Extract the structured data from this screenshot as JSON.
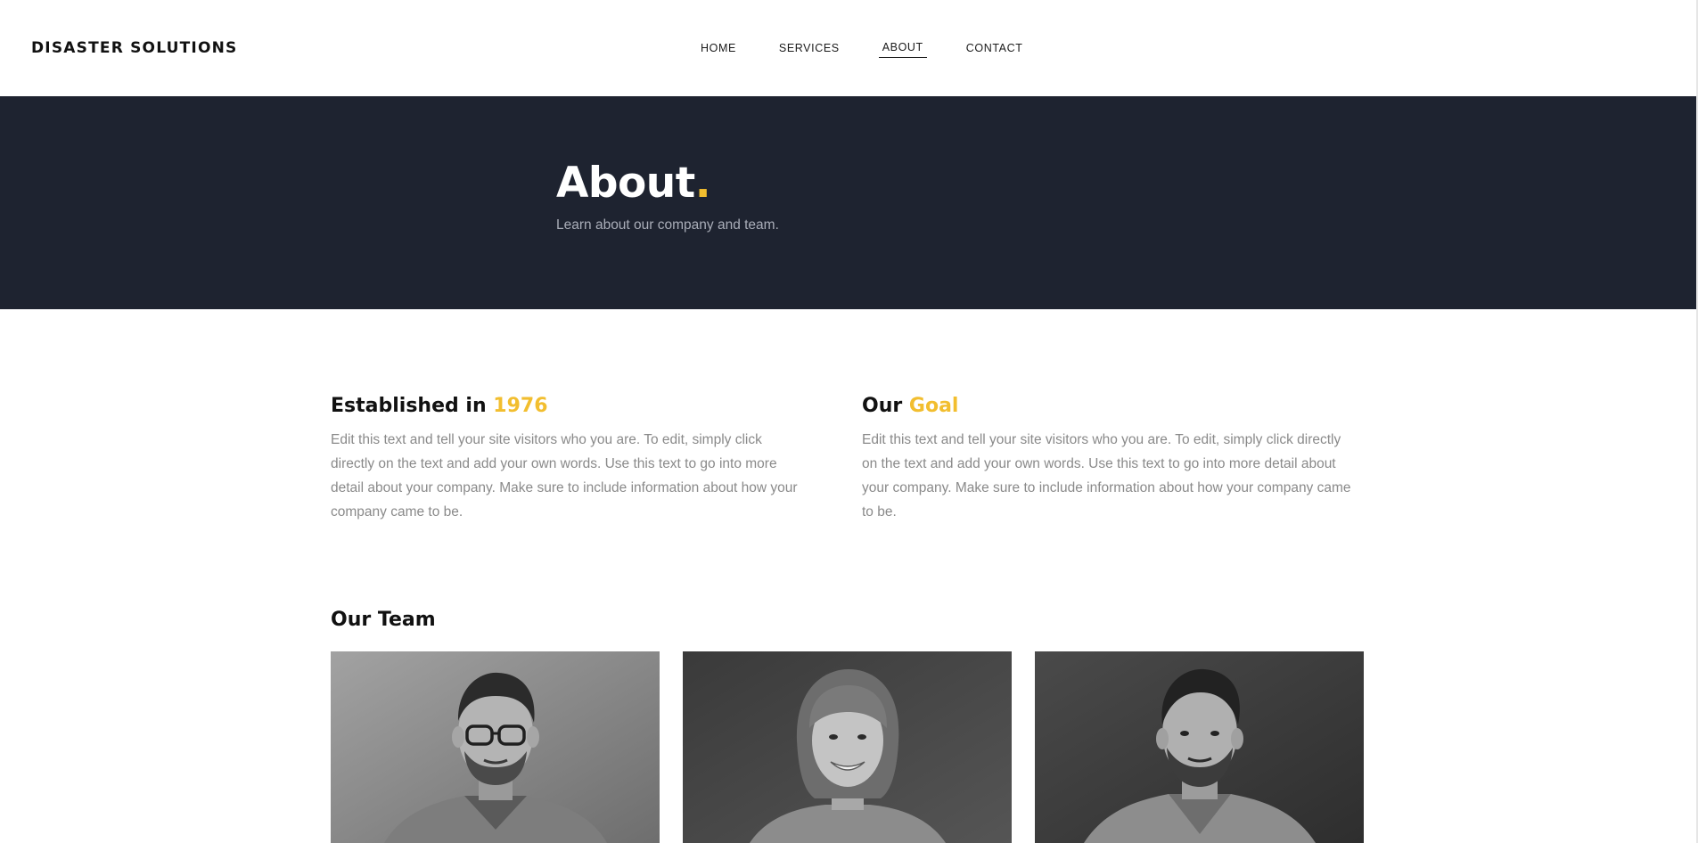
{
  "header": {
    "brand": "DISASTER SOLUTIONS",
    "nav": [
      {
        "label": "HOME"
      },
      {
        "label": "SERVICES"
      },
      {
        "label": "ABOUT"
      },
      {
        "label": "CONTACT"
      }
    ],
    "active_nav": "ABOUT"
  },
  "hero": {
    "title": "About",
    "title_dot": ".",
    "subtitle": "Learn about our company and team."
  },
  "established": {
    "heading_prefix": "Established in",
    "heading_accent": "1976",
    "body": "Edit this text and tell your site visitors who you are. To edit, simply click directly on the text and add your own words. Use this text to go into more detail about your company. Make sure to include information about how your company came to be."
  },
  "goal": {
    "heading_prefix": "Our",
    "heading_accent": "Goal",
    "body": "Edit this text and tell your site visitors who you are. To edit, simply click directly on the text and add your own words. Use this text to go into more detail about your company. Make sure to include information about how your company came to be."
  },
  "team": {
    "title": "Our Team",
    "members": [
      {
        "photo": "man-glasses-portrait"
      },
      {
        "photo": "woman-bob-portrait"
      },
      {
        "photo": "man-beard-portrait"
      }
    ]
  },
  "colors": {
    "accent": "#f2be2f",
    "hero_bg": "#1e2330",
    "body_text": "#8a8a8a",
    "heading_text": "#111111"
  }
}
